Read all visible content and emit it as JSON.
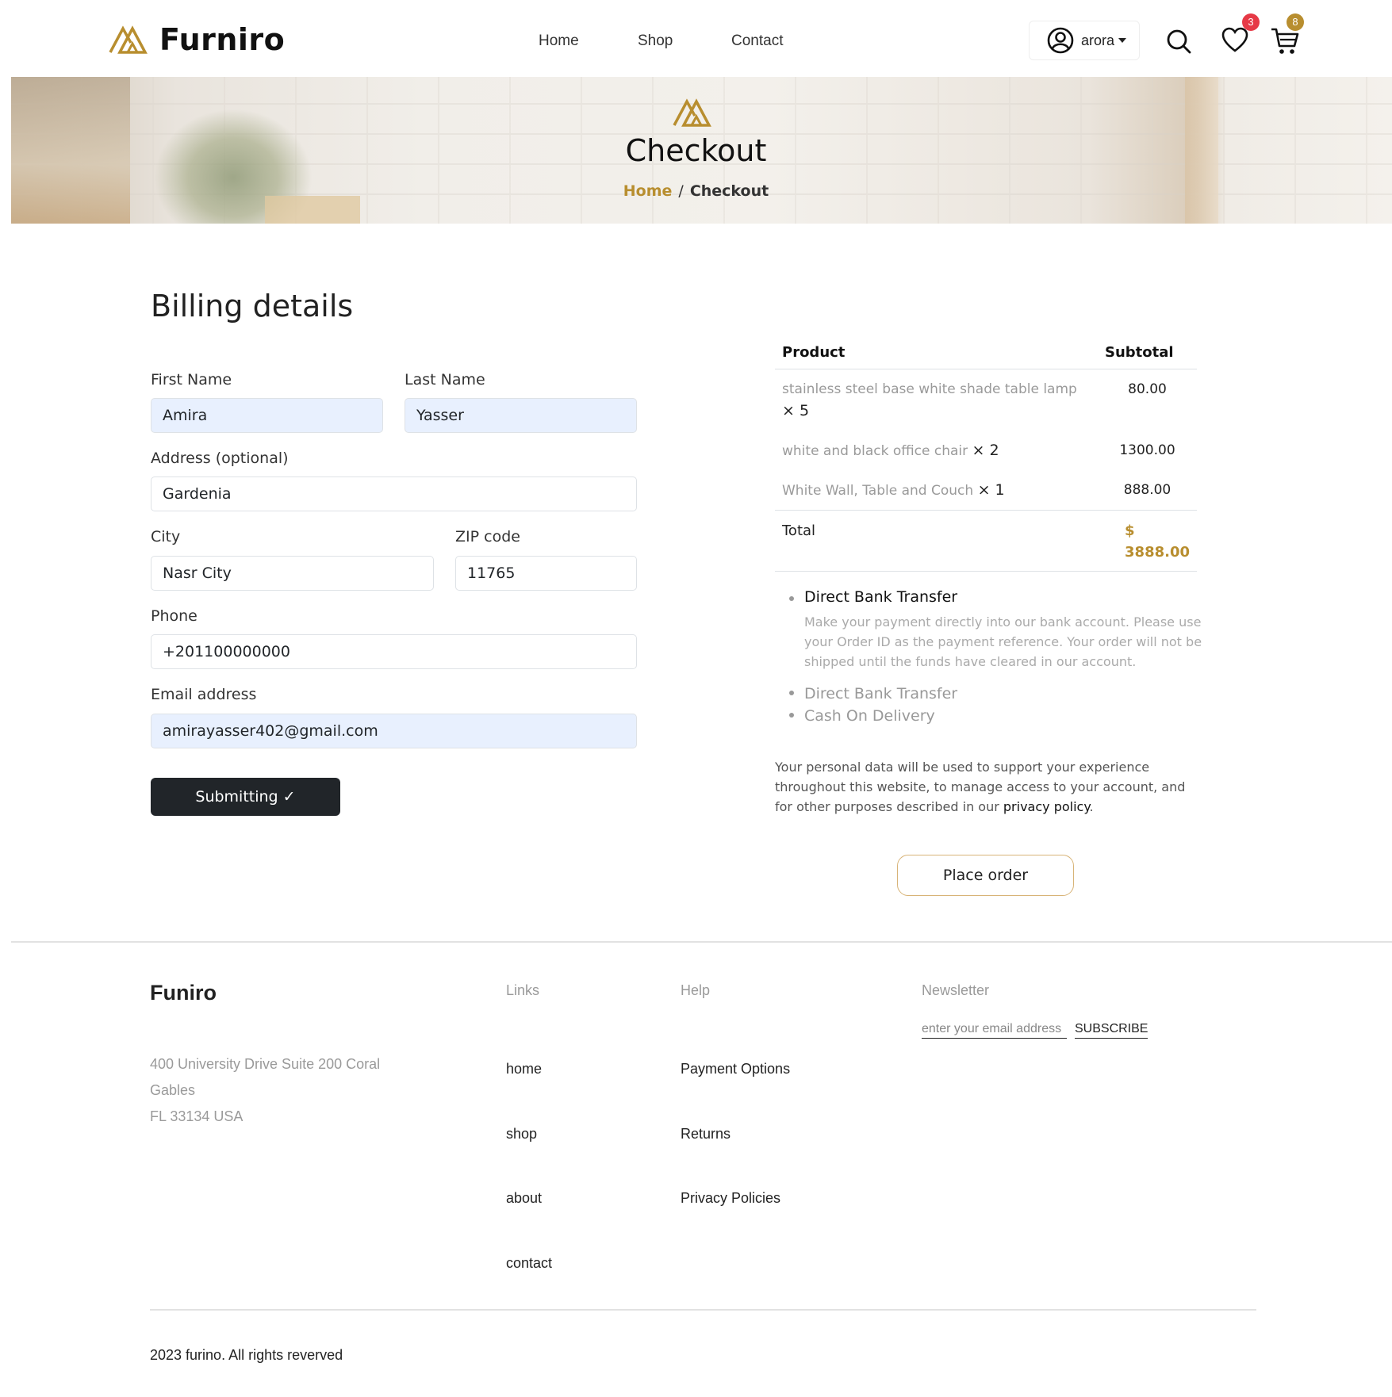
{
  "header": {
    "brand": "Furniro",
    "nav": [
      {
        "label": "Home"
      },
      {
        "label": "Shop"
      },
      {
        "label": "Contact"
      }
    ],
    "user": {
      "name": "arora"
    },
    "wishlist_count": "3",
    "cart_count": "8",
    "colors": {
      "accent": "#b88e2f",
      "wishlist_badge": "#e63946",
      "cart_badge": "#b88e2f"
    }
  },
  "hero": {
    "title": "Checkout",
    "breadcrumb": {
      "home": "Home",
      "separator": "/",
      "current": "Checkout"
    }
  },
  "billing": {
    "title": "Billing details",
    "first_name": {
      "label": "First Name",
      "value": "Amira"
    },
    "last_name": {
      "label": "Last Name",
      "value": "Yasser"
    },
    "address": {
      "label": "Address (optional)",
      "value": "Gardenia"
    },
    "city": {
      "label": "City",
      "value": "Nasr City"
    },
    "zip": {
      "label": "ZIP code",
      "value": "11765"
    },
    "phone": {
      "label": "Phone",
      "value": "+201100000000"
    },
    "email": {
      "label": "Email address",
      "value": "amirayasser402@gmail.com"
    },
    "submit_label": "Submitting ✓"
  },
  "order": {
    "headers": {
      "product": "Product",
      "subtotal": "Subtotal"
    },
    "items": [
      {
        "name": "stainless steel base white shade table lamp",
        "qty": "× 5",
        "subtotal": "80.00"
      },
      {
        "name": "white and black office chair",
        "qty": "× 2",
        "subtotal": "1300.00"
      },
      {
        "name": "White Wall, Table and Couch",
        "qty": "× 1",
        "subtotal": "888.00"
      }
    ],
    "total_label": "Total",
    "total_currency": "$",
    "total_value": "3888.00"
  },
  "payment": {
    "selected": "Direct Bank Transfer",
    "description": "Make your payment directly into our bank account. Please use your Order ID as the payment reference. Your order will not be shipped until the funds have cleared in our account.",
    "options": [
      "Direct Bank Transfer",
      "Cash On Delivery"
    ]
  },
  "privacy": {
    "text": "Your personal data will be used to support your experience throughout this website, to manage access to your account, and for other purposes described in our ",
    "link": "privacy policy",
    "end": "."
  },
  "place_order_label": "Place order",
  "footer": {
    "brand": "Funiro",
    "address_lines": [
      "400 University Drive Suite 200 Coral",
      "Gables",
      "FL 33134 USA"
    ],
    "links_heading": "Links",
    "links": [
      "home",
      "shop",
      "about",
      "contact"
    ],
    "help_heading": "Help",
    "help": [
      "Payment Options",
      "Returns",
      "Privacy Policies"
    ],
    "newsletter_heading": "Newsletter",
    "newsletter_placeholder": "enter your email address",
    "subscribe_label": "SUBSCRIBE",
    "copyright": "2023 furino. All rights reverved"
  }
}
